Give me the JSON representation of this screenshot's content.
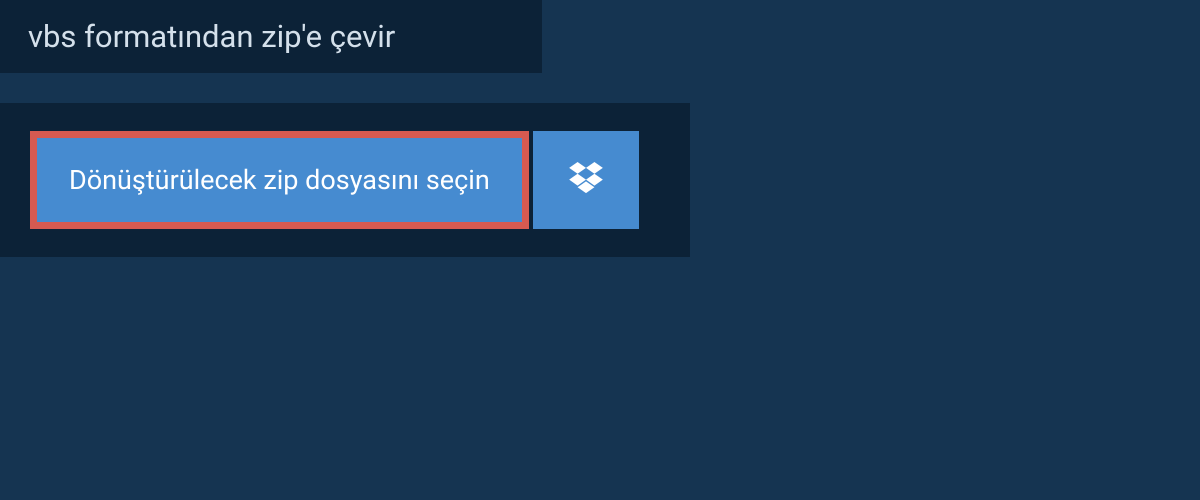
{
  "header": {
    "title": "vbs formatından zip'e çevir"
  },
  "panel": {
    "select_button_label": "Dönüştürülecek zip dosyasını seçin",
    "dropbox_icon_name": "dropbox"
  },
  "colors": {
    "background": "#153451",
    "panel_dark": "#0c2237",
    "button_blue": "#468bd0",
    "highlight_border": "#d65a51",
    "text_light": "#d4e0eb",
    "text_white": "#ffffff"
  }
}
